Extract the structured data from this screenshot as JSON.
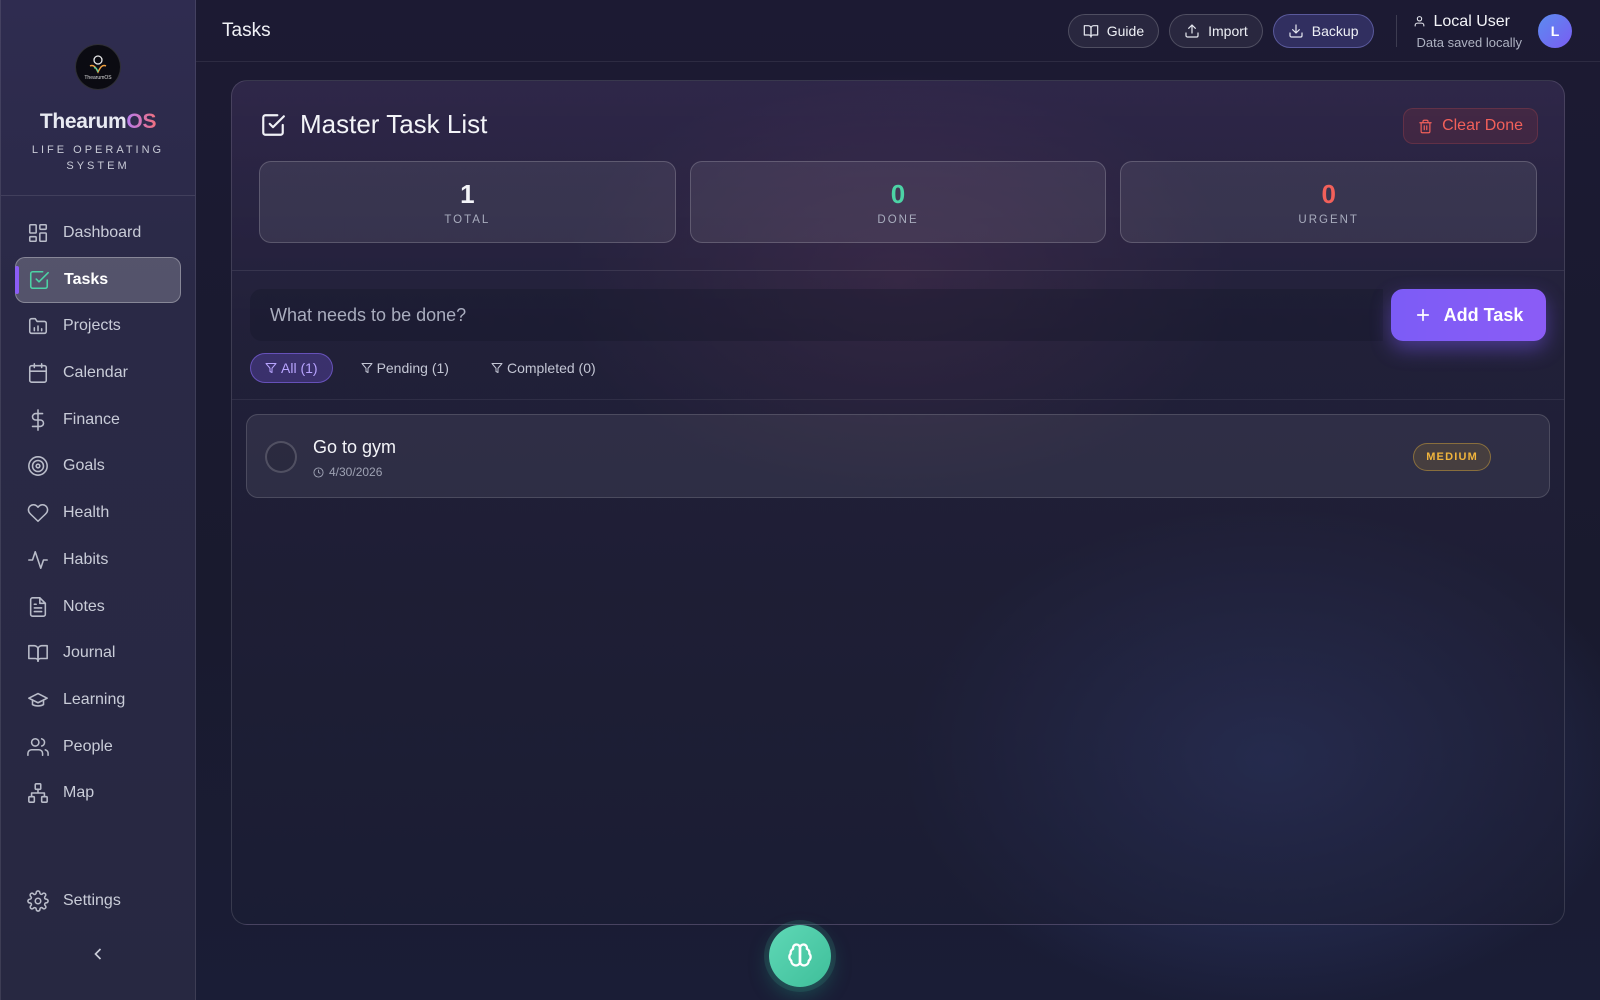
{
  "sidebar": {
    "brand_name": "Thearum",
    "brand_suffix": "OS",
    "logo_text": "ThearumOS",
    "brand_sub_line1": "LIFE OPERATING",
    "brand_sub_line2": "SYSTEM",
    "items": [
      {
        "label": "Dashboard",
        "icon": "layout-grid-icon"
      },
      {
        "label": "Tasks",
        "icon": "check-square-icon",
        "active": true
      },
      {
        "label": "Projects",
        "icon": "folder-icon"
      },
      {
        "label": "Calendar",
        "icon": "calendar-icon"
      },
      {
        "label": "Finance",
        "icon": "dollar-icon"
      },
      {
        "label": "Goals",
        "icon": "target-icon"
      },
      {
        "label": "Health",
        "icon": "heart-icon"
      },
      {
        "label": "Habits",
        "icon": "activity-icon"
      },
      {
        "label": "Notes",
        "icon": "file-text-icon"
      },
      {
        "label": "Journal",
        "icon": "book-open-icon"
      },
      {
        "label": "Learning",
        "icon": "graduation-cap-icon"
      },
      {
        "label": "People",
        "icon": "users-icon"
      },
      {
        "label": "Map",
        "icon": "network-icon"
      }
    ],
    "settings_label": "Settings"
  },
  "header": {
    "title": "Tasks",
    "guide_label": "Guide",
    "import_label": "Import",
    "backup_label": "Backup",
    "user_name": "Local User",
    "user_status": "Data saved locally",
    "avatar_initial": "L"
  },
  "main": {
    "title": "Master Task List",
    "clear_label": "Clear Done",
    "stats": {
      "total_value": "1",
      "total_label": "TOTAL",
      "done_value": "0",
      "done_label": "DONE",
      "urgent_value": "0",
      "urgent_label": "URGENT"
    },
    "input_placeholder": "What needs to be done?",
    "add_label": "Add Task",
    "filters": {
      "all": "All (1)",
      "pending": "Pending (1)",
      "completed": "Completed (0)"
    },
    "tasks": [
      {
        "name": "Go to gym",
        "date": "4/30/2026",
        "priority": "MEDIUM"
      }
    ]
  },
  "colors": {
    "accent": "#8b5cf6",
    "done": "#4cd3a5",
    "urgent": "#f2605a",
    "medium": "#f0b43c"
  }
}
